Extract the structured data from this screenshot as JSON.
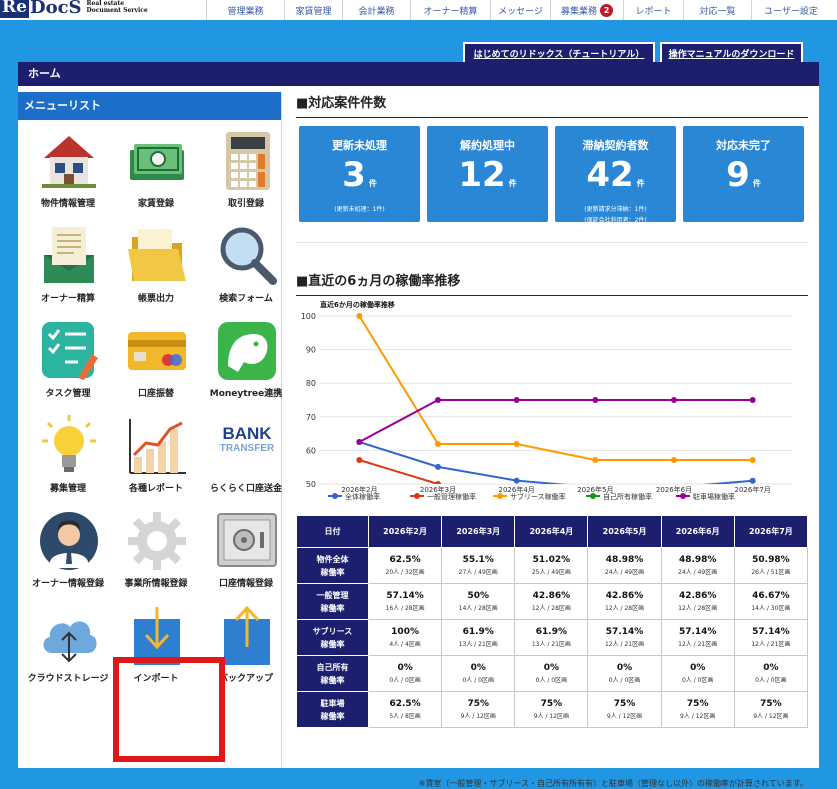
{
  "logo": {
    "mark": "Re",
    "name": "DocS",
    "sub1": "Real estate",
    "sub2": "Document Service"
  },
  "topnav": [
    {
      "label": "管理業務",
      "w": 78
    },
    {
      "label": "家賃管理",
      "w": 58
    },
    {
      "label": "会計業務",
      "w": 68
    },
    {
      "label": "オーナー精算",
      "w": 80
    },
    {
      "label": "メッセージ",
      "w": 60
    },
    {
      "label": "募集業務",
      "w": 73,
      "badge": "2"
    },
    {
      "label": "レポート",
      "w": 60
    },
    {
      "label": "対応一覧",
      "w": 68
    },
    {
      "label": "ユーザー設定",
      "w": 79
    }
  ],
  "buttons": {
    "tutorial": "はじめてのリドックス（チュートリアル）",
    "manual": "操作マニュアルのダウンロード"
  },
  "home_label": "ホーム",
  "menu": {
    "title": "メニューリスト",
    "items": [
      {
        "label": "物件情報管理",
        "icon": "house-icon"
      },
      {
        "label": "家賃登録",
        "icon": "banknote-icon"
      },
      {
        "label": "取引登録",
        "icon": "calculator-icon"
      },
      {
        "label": "オーナー精算",
        "icon": "envelope-icon"
      },
      {
        "label": "帳票出力",
        "icon": "folder-icon"
      },
      {
        "label": "検索フォーム",
        "icon": "magnifier-icon"
      },
      {
        "label": "タスク管理",
        "icon": "checklist-icon"
      },
      {
        "label": "口座振替",
        "icon": "credit-card-icon"
      },
      {
        "label": "Moneytree連携",
        "icon": "moneytree-icon"
      },
      {
        "label": "募集管理",
        "icon": "lightbulb-icon"
      },
      {
        "label": "各種レポート",
        "icon": "bar-chart-icon"
      },
      {
        "label": "らくらく口座送金",
        "icon": "bank-transfer-icon",
        "bank1": "BANK",
        "bank2": "TRANSFER"
      },
      {
        "label": "オーナー情報登録",
        "icon": "owner-icon"
      },
      {
        "label": "事業所情報登録",
        "icon": "gear-icon"
      },
      {
        "label": "口座情報登録",
        "icon": "safe-icon"
      },
      {
        "label": "クラウドストレージ",
        "icon": "cloud-icon"
      },
      {
        "label": "インポート",
        "icon": "import-icon"
      },
      {
        "label": "バックアップ",
        "icon": "backup-icon"
      }
    ]
  },
  "cases": {
    "title": "■対応案件件数",
    "unit": "件",
    "cards": [
      {
        "title": "更新未処理",
        "value": "3",
        "notes": [
          "(更新未処理：1件)"
        ]
      },
      {
        "title": "解約処理中",
        "value": "12",
        "notes": []
      },
      {
        "title": "滞納契約者数",
        "value": "42",
        "notes": [
          "(更新請求分滞納：1件)",
          "(保証会社利用者：2件)"
        ]
      },
      {
        "title": "対応未完了",
        "value": "9",
        "notes": []
      }
    ]
  },
  "occupancy_title": "■直近の6ヵ月の稼働率推移",
  "chart_data": {
    "type": "line",
    "title": "直近6か月の稼働率推移",
    "categories": [
      "2026年2月",
      "2026年3月",
      "2026年4月",
      "2026年5月",
      "2026年6月",
      "2026年7月"
    ],
    "ylim": [
      50,
      100
    ],
    "yticks": [
      50,
      60,
      70,
      80,
      90,
      100
    ],
    "grid": true,
    "legend_position": "bottom",
    "series": [
      {
        "name": "全体稼働率",
        "color": "#3366cc",
        "values": [
          62.5,
          55.1,
          51.02,
          48.98,
          48.98,
          50.98
        ]
      },
      {
        "name": "一般管理稼働率",
        "color": "#dc3912",
        "values": [
          57.14,
          50,
          42.86,
          42.86,
          42.86,
          46.67
        ]
      },
      {
        "name": "サブリース稼働率",
        "color": "#ff9900",
        "values": [
          100,
          61.9,
          61.9,
          57.14,
          57.14,
          57.14
        ]
      },
      {
        "name": "自己所有稼働率",
        "color": "#109618",
        "values": [
          0,
          0,
          0,
          0,
          0,
          0
        ]
      },
      {
        "name": "駐車場稼働率",
        "color": "#990099",
        "values": [
          62.5,
          75,
          75,
          75,
          75,
          75
        ]
      }
    ]
  },
  "table": {
    "corner": "日付",
    "months": [
      "2026年2月",
      "2026年3月",
      "2026年4月",
      "2026年5月",
      "2026年6月",
      "2026年7月"
    ],
    "rows": [
      {
        "head1": "物件全体",
        "head2": "稼働率",
        "cells": [
          [
            "62.5%",
            "20人 / 32区画"
          ],
          [
            "55.1%",
            "27人 / 49区画"
          ],
          [
            "51.02%",
            "25人 / 49区画"
          ],
          [
            "48.98%",
            "24人 / 49区画"
          ],
          [
            "48.98%",
            "24人 / 49区画"
          ],
          [
            "50.98%",
            "26人 / 51区画"
          ]
        ]
      },
      {
        "head1": "一般管理",
        "head2": "稼働率",
        "cells": [
          [
            "57.14%",
            "16人 / 28区画"
          ],
          [
            "50%",
            "14人 / 28区画"
          ],
          [
            "42.86%",
            "12人 / 28区画"
          ],
          [
            "42.86%",
            "12人 / 28区画"
          ],
          [
            "42.86%",
            "12人 / 28区画"
          ],
          [
            "46.67%",
            "14人 / 30区画"
          ]
        ]
      },
      {
        "head1": "サブリース",
        "head2": "稼働率",
        "cells": [
          [
            "100%",
            "4人 / 4区画"
          ],
          [
            "61.9%",
            "13人 / 21区画"
          ],
          [
            "61.9%",
            "13人 / 21区画"
          ],
          [
            "57.14%",
            "12人 / 21区画"
          ],
          [
            "57.14%",
            "12人 / 21区画"
          ],
          [
            "57.14%",
            "12人 / 21区画"
          ]
        ]
      },
      {
        "head1": "自己所有",
        "head2": "稼働率",
        "cells": [
          [
            "0%",
            "0人 / 0区画"
          ],
          [
            "0%",
            "0人 / 0区画"
          ],
          [
            "0%",
            "0人 / 0区画"
          ],
          [
            "0%",
            "0人 / 0区画"
          ],
          [
            "0%",
            "0人 / 0区画"
          ],
          [
            "0%",
            "0人 / 0区画"
          ]
        ]
      },
      {
        "head1": "駐車場",
        "head2": "稼働率",
        "cells": [
          [
            "62.5%",
            "5人 / 8区画"
          ],
          [
            "75%",
            "9人 / 12区画"
          ],
          [
            "75%",
            "9人 / 12区画"
          ],
          [
            "75%",
            "9人 / 12区画"
          ],
          [
            "75%",
            "9人 / 12区画"
          ],
          [
            "75%",
            "9人 / 12区画"
          ]
        ]
      }
    ]
  },
  "footnote": "※賃室（一般管理・サブリース・自己所有所有有）と駐車場（管理なし以外）の稼働率が計算されています。"
}
